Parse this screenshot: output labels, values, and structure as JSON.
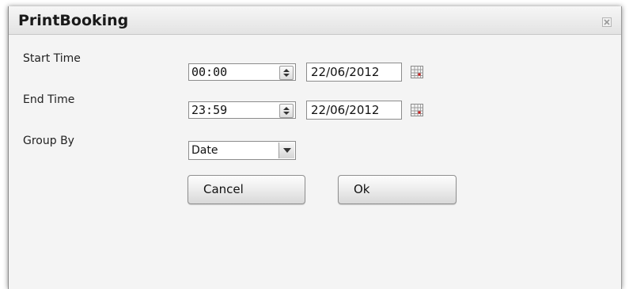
{
  "dialog": {
    "title": "PrintBooking"
  },
  "form": {
    "start_time": {
      "label": "Start Time",
      "time": "00:00",
      "date": "22/06/2012"
    },
    "end_time": {
      "label": "End Time",
      "time": "23:59",
      "date": "22/06/2012"
    },
    "group_by": {
      "label": "Group By",
      "selected": "Date"
    }
  },
  "buttons": {
    "cancel": "Cancel",
    "ok": "Ok"
  },
  "icons": {
    "close": "close-icon",
    "calendar": "calendar-icon",
    "spinner": "spinner-updown-icon",
    "dropdown": "chevron-down-icon"
  }
}
